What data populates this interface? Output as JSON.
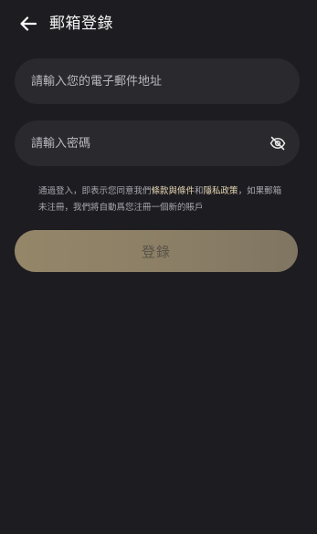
{
  "header": {
    "back_icon": "arrow-left-icon",
    "title": "郵箱登錄"
  },
  "form": {
    "email": {
      "value": "",
      "placeholder": "請輸入您的電子郵件地址"
    },
    "password": {
      "value": "",
      "placeholder": "請輸入密碼",
      "toggle_icon": "eye-off-icon"
    }
  },
  "terms": {
    "prefix": "通過登入，即表示您同意我們",
    "terms_link": "條款與條件",
    "and": "和",
    "privacy_link": "隱私政策",
    "suffix": "，如果郵箱未注冊，我們將自動爲您注冊一個新的賬戶"
  },
  "actions": {
    "login_label": "登錄"
  },
  "colors": {
    "background": "#1d1c21",
    "field_bg": "#2a292e",
    "accent_link": "#e8d9b4",
    "button_bg": "#948668"
  }
}
